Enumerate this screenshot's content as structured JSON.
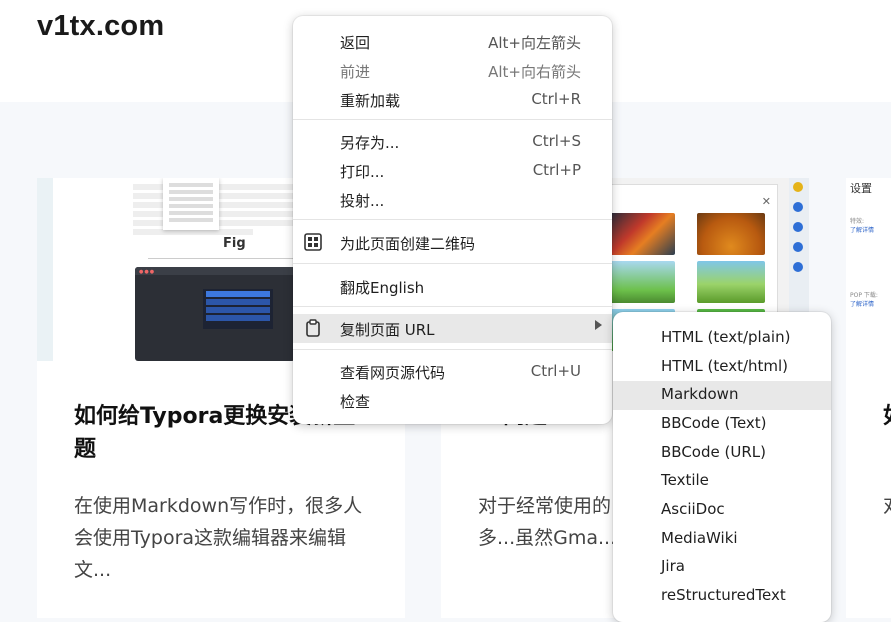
{
  "site": {
    "logo": "v1tx.com"
  },
  "cards": [
    {
      "title": "如何给Typora更换安装新主题",
      "excerpt": "在使用Markdown写作时，很多人会使用Typora这款编辑器来编辑文...",
      "thumb": {
        "fig_label": "Fig"
      }
    },
    {
      "title": "...问题",
      "excerpt": "对于经常使用的...说，每天要很多...虽然Gma...",
      "thumb": {}
    },
    {
      "title": "如...",
      "excerpt": "对...",
      "thumb": {
        "title": "设置",
        "line1": "特效:",
        "line2": "了解详情",
        "line3": "POP 下载:",
        "line4": "了解详情"
      }
    }
  ],
  "context_menu": {
    "items": [
      {
        "label": "返回",
        "shortcut": "Alt+向左箭头",
        "enabled": true
      },
      {
        "label": "前进",
        "shortcut": "Alt+向右箭头",
        "enabled": false
      },
      {
        "label": "重新加载",
        "shortcut": "Ctrl+R",
        "enabled": true
      },
      {
        "label": "另存为...",
        "shortcut": "Ctrl+S",
        "enabled": true
      },
      {
        "label": "打印...",
        "shortcut": "Ctrl+P",
        "enabled": true
      },
      {
        "label": "投射...",
        "shortcut": "",
        "enabled": true
      },
      {
        "label": "为此页面创建二维码",
        "shortcut": "",
        "enabled": true,
        "icon": "qr-code-icon"
      },
      {
        "label": "翻成English",
        "shortcut": "",
        "enabled": true
      },
      {
        "label": "复制页面 URL",
        "shortcut": "",
        "enabled": true,
        "icon": "clipboard-icon",
        "highlighted": true
      },
      {
        "label": "查看网页源代码",
        "shortcut": "Ctrl+U",
        "enabled": true
      },
      {
        "label": "检查",
        "shortcut": "",
        "enabled": true
      }
    ]
  },
  "submenu": {
    "items": [
      {
        "label": "HTML (text/plain)"
      },
      {
        "label": "HTML (text/html)"
      },
      {
        "label": "Markdown",
        "highlighted": true
      },
      {
        "label": "BBCode (Text)"
      },
      {
        "label": "BBCode (URL)"
      },
      {
        "label": "Textile"
      },
      {
        "label": "AsciiDoc"
      },
      {
        "label": "MediaWiki"
      },
      {
        "label": "Jira"
      },
      {
        "label": "reStructuredText"
      }
    ]
  },
  "colors": {
    "highlight": "#e8e8e8",
    "background": "#f6f8fb",
    "link": "#2a62c9"
  }
}
